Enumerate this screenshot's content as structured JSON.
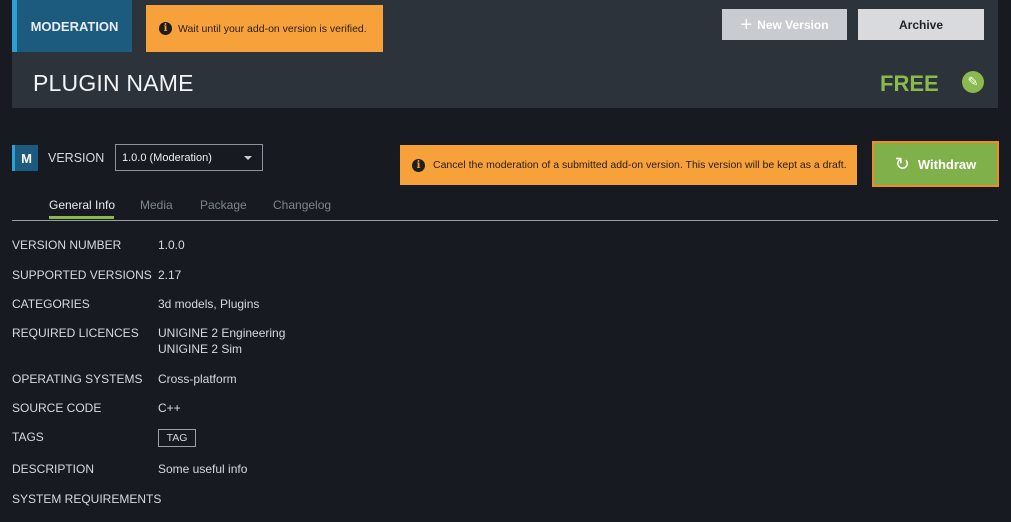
{
  "header": {
    "status_badge": "MODERATION",
    "notice": "Wait until your add-on version is verified.",
    "new_version_label": "New Version",
    "archive_label": "Archive",
    "plugin_name": "PLUGIN NAME",
    "price": "FREE",
    "icons": {
      "info": "info-icon",
      "plus": "plus-icon",
      "edit": "pencil-icon"
    }
  },
  "version_bar": {
    "badge_letter": "M",
    "label": "VERSION",
    "selected_version": "1.0.0 (Moderation)",
    "notice": "Cancel the moderation of a submitted add-on version. This version will be kept as a draft.",
    "withdraw_label": "Withdraw",
    "icons": {
      "dropdown": "chevron-down-icon",
      "withdraw": "refresh-icon"
    }
  },
  "tabs": [
    {
      "label": "General Info",
      "active": true
    },
    {
      "label": "Media",
      "active": false
    },
    {
      "label": "Package",
      "active": false
    },
    {
      "label": "Changelog",
      "active": false
    }
  ],
  "details": [
    {
      "label": "VERSION NUMBER",
      "value": "1.0.0"
    },
    {
      "label": "SUPPORTED VERSIONS",
      "value": "2.17"
    },
    {
      "label": "CATEGORIES",
      "value": "3d models, Plugins"
    },
    {
      "label": "REQUIRED LICENCES",
      "value": "UNIGINE 2 Engineering",
      "value2": "UNIGINE 2 Sim"
    },
    {
      "label": "OPERATING SYSTEMS",
      "value": "Cross-platform"
    },
    {
      "label": "SOURCE CODE",
      "value": "C++"
    },
    {
      "label": "TAGS",
      "value": "TAG"
    },
    {
      "label": "DESCRIPTION",
      "value": "Some useful info"
    },
    {
      "label": "SYSTEM REQUIREMENTS",
      "value": ""
    }
  ],
  "colors": {
    "background": "#171b21",
    "header_panel": "#2c333b",
    "accent_blue": "#1c5a7e",
    "warning_orange": "#f7a13b",
    "success_green": "#8ab94e",
    "withdraw_border": "#f28a28"
  }
}
